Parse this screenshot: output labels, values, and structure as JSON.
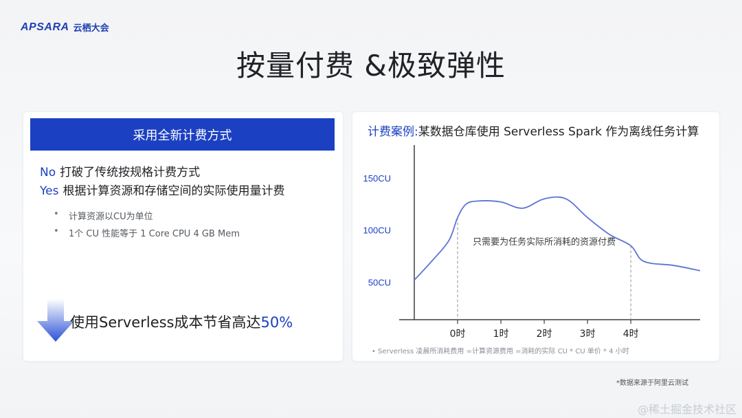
{
  "header": {
    "logo_mark": "APSARA",
    "logo_text": "云栖大会",
    "title": "按量付费 &极致弹性"
  },
  "left_panel": {
    "header": "采用全新计费方式",
    "lines": [
      {
        "keyword": "No",
        "text": "打破了传统按规格计费方式"
      },
      {
        "keyword": "Yes",
        "text": "根据计算资源和存储空间的实际使用量计费"
      }
    ],
    "bullets": [
      "计算资源以CU为单位",
      "1个 CU 性能等于 1 Core CPU 4 GB Mem"
    ],
    "savings_prefix": "使用Serverless成本节省高达",
    "savings_value": "50%"
  },
  "right_panel": {
    "title_highlight": "计费案例:",
    "title_rest": "某数据仓库使用 Serverless Spark 作为离线任务计算",
    "footnote": "• Serverless 凌晨所消耗费用 =计算资源费用 =消耗的实际 CU * CU 单价 * 4 小时"
  },
  "chart_data": {
    "type": "line",
    "y_tick_labels": [
      "150CU",
      "100CU",
      "50CU"
    ],
    "y_ticks": [
      150,
      100,
      50
    ],
    "x_tick_labels": [
      "0时",
      "1时",
      "2时",
      "3时",
      "4时"
    ],
    "x_ticks": [
      0,
      1,
      2,
      3,
      4
    ],
    "xlim": [
      -1,
      5.6
    ],
    "ylim": [
      14,
      175
    ],
    "annotation": "只需要为任务实际所消耗的资源付费",
    "series": [
      {
        "color": "#5b73d6",
        "x": [
          -1.0,
          -0.6,
          -0.2,
          0.0,
          0.2,
          0.5,
          1.0,
          1.5,
          2.0,
          2.5,
          3.0,
          3.5,
          4.0,
          4.3,
          5.0,
          5.6
        ],
        "y": [
          52,
          70,
          90,
          112,
          125,
          128,
          127,
          121,
          130,
          130,
          112,
          96,
          85,
          70,
          66,
          61
        ]
      }
    ],
    "dashed_markers_x": [
      0,
      4
    ],
    "grid": false,
    "colors": {
      "accent": "#1b40c2",
      "line": "#5b73d6"
    }
  },
  "footer": {
    "source": "*数据来源于阿里云测试",
    "watermark": "@稀土掘金技术社区"
  }
}
